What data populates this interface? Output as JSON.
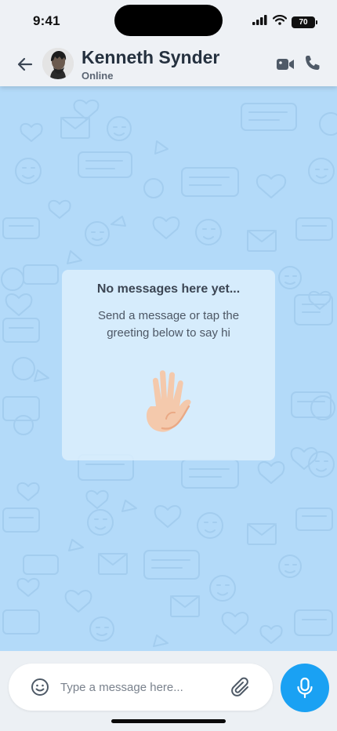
{
  "status_bar": {
    "time": "9:41",
    "battery": "70"
  },
  "header": {
    "contact_name": "Kenneth Synder",
    "contact_status": "Online"
  },
  "empty_state": {
    "title": "No messages here yet...",
    "subtitle": "Send a message or tap the greeting below to say hi"
  },
  "composer": {
    "placeholder": "Type a message here..."
  },
  "icons": {
    "back": "arrow-left-icon",
    "video": "video-camera-icon",
    "call": "phone-icon",
    "emoji": "smiley-icon",
    "attach": "paperclip-icon",
    "mic": "microphone-icon",
    "wave": "waving-hand-icon"
  },
  "colors": {
    "wallpaper": "#b3daf9",
    "accent": "#1aa1f3",
    "header_bg": "#eef1f5"
  }
}
